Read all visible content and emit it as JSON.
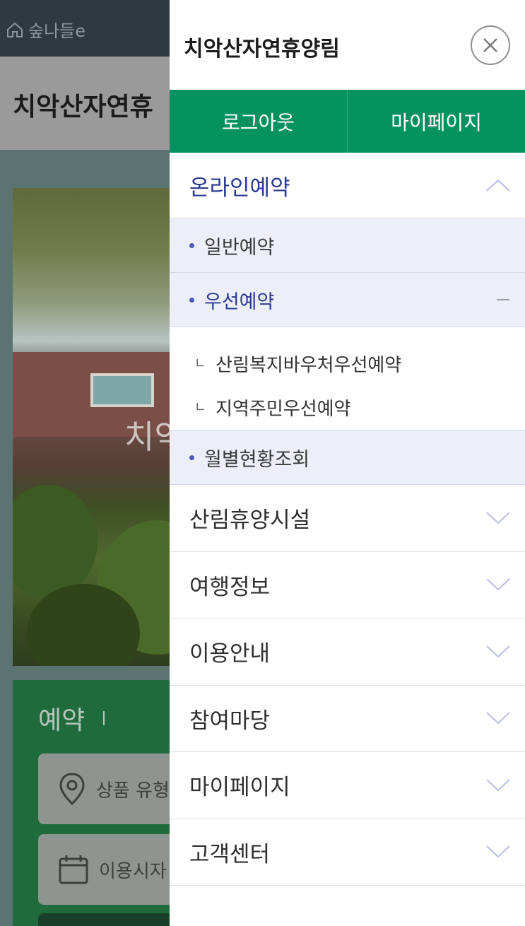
{
  "background": {
    "brand": "숲나들e",
    "title": "치악산자연휴",
    "hero_overlay_text": "치악",
    "reservation": {
      "title": "예약",
      "fields": [
        "상품 유형",
        "이용시자"
      ]
    }
  },
  "drawer": {
    "title": "치악산자연휴양림",
    "close_icon": "close-icon",
    "auth": {
      "logout": "로그아웃",
      "mypage": "마이페이지"
    },
    "menu": {
      "online": {
        "label": "온라인예약",
        "sub": [
          {
            "label": "일반예약"
          },
          {
            "label": "우선예약",
            "sub": [
              "산림복지바우처우선예약",
              "지역주민우선예약"
            ]
          },
          {
            "label": "월별현황조회"
          }
        ]
      },
      "items": [
        "산림휴양시설",
        "여행정보",
        "이용안내",
        "참여마당",
        "마이페이지",
        "고객센터"
      ]
    }
  },
  "colors": {
    "green": "#049261",
    "active_text": "#2b3a8f",
    "sub_bg": "#eceef8",
    "chevron": "#b9bde6"
  }
}
